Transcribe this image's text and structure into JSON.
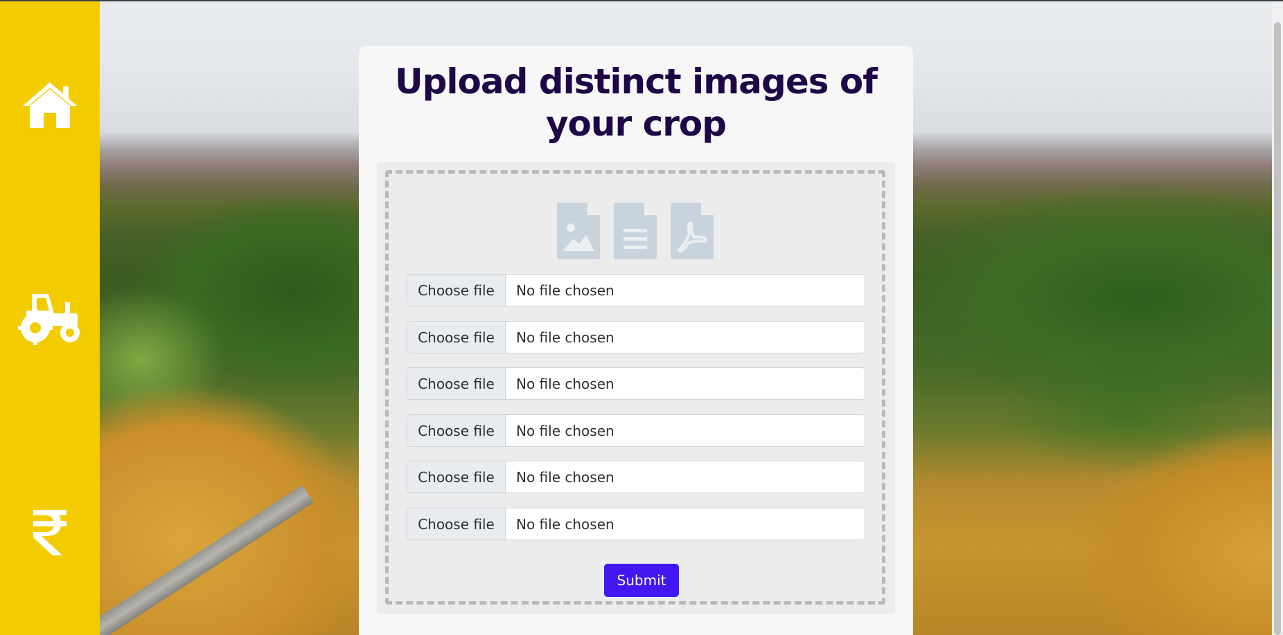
{
  "sidebar": {
    "items": [
      {
        "icon": "home-icon"
      },
      {
        "icon": "tractor-icon"
      },
      {
        "icon": "rupee-icon"
      }
    ],
    "background_color": "#f3cc00"
  },
  "upload": {
    "title": "Upload distinct images of your crop",
    "file_type_icons": [
      "image-file-icon",
      "text-file-icon",
      "pdf-file-icon"
    ],
    "file_inputs": [
      {
        "button_label": "Choose file",
        "status": "No file chosen"
      },
      {
        "button_label": "Choose file",
        "status": "No file chosen"
      },
      {
        "button_label": "Choose file",
        "status": "No file chosen"
      },
      {
        "button_label": "Choose file",
        "status": "No file chosen"
      },
      {
        "button_label": "Choose file",
        "status": "No file chosen"
      },
      {
        "button_label": "Choose file",
        "status": "No file chosen"
      }
    ],
    "submit_label": "Submit"
  },
  "colors": {
    "title": "#1d0746",
    "submit": "#4318f0",
    "icon_gray": "#c9d3dd"
  }
}
